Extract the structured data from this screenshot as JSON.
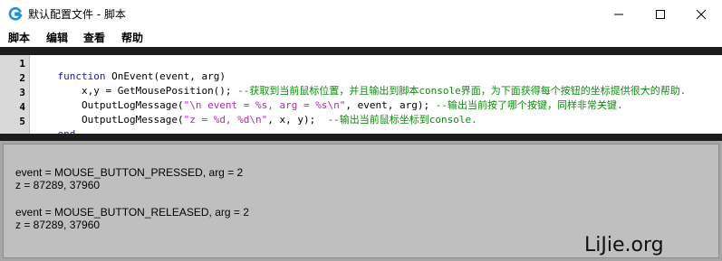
{
  "window": {
    "title": "默认配置文件 - 脚本",
    "app_icon": "logitech-g-icon",
    "controls": [
      "minimize-icon",
      "maximize-icon",
      "close-icon"
    ]
  },
  "menu": {
    "items": [
      "脚本",
      "编辑",
      "查看",
      "帮助"
    ]
  },
  "editor": {
    "line_numbers": [
      "1",
      "2",
      "3",
      "4",
      "5"
    ],
    "lines": [
      [
        {
          "t": "kw",
          "v": "function"
        },
        {
          "t": "plain",
          "v": " OnEvent(event, arg)"
        }
      ],
      [
        {
          "t": "plain",
          "v": "    x,y = GetMousePosition(); "
        },
        {
          "t": "cmt",
          "v": "--获取到当前鼠标位置，并且输出到脚本console界面，为下面获得每个按钮的坐标提供很大的帮助."
        }
      ],
      [
        {
          "t": "plain",
          "v": "    OutputLogMessage("
        },
        {
          "t": "str",
          "v": "\"\\n event = %s, arg = %s\\n\""
        },
        {
          "t": "plain",
          "v": ", event, arg); "
        },
        {
          "t": "cmt",
          "v": "--输出当前按了哪个按键，同样非常关键."
        }
      ],
      [
        {
          "t": "plain",
          "v": "    OutputLogMessage("
        },
        {
          "t": "str",
          "v": "\"z = %d, %d\\n\""
        },
        {
          "t": "plain",
          "v": ", x, y);  "
        },
        {
          "t": "cmt",
          "v": "--输出当前鼠标坐标到console."
        }
      ],
      [
        {
          "t": "kw",
          "v": "end"
        }
      ]
    ]
  },
  "console": {
    "lines": [
      "event = MOUSE_BUTTON_PRESSED, arg = 2",
      "z = 87289, 37960",
      "event = MOUSE_BUTTON_RELEASED, arg = 2",
      "z = 87289, 37960"
    ],
    "watermark": "LiJie.org"
  },
  "colors": {
    "keyword": "#1a1ab2",
    "string": "#b02ab0",
    "comment": "#118a11",
    "console_bg": "#bfbfbf",
    "editor_border": "#1c1c1c"
  }
}
